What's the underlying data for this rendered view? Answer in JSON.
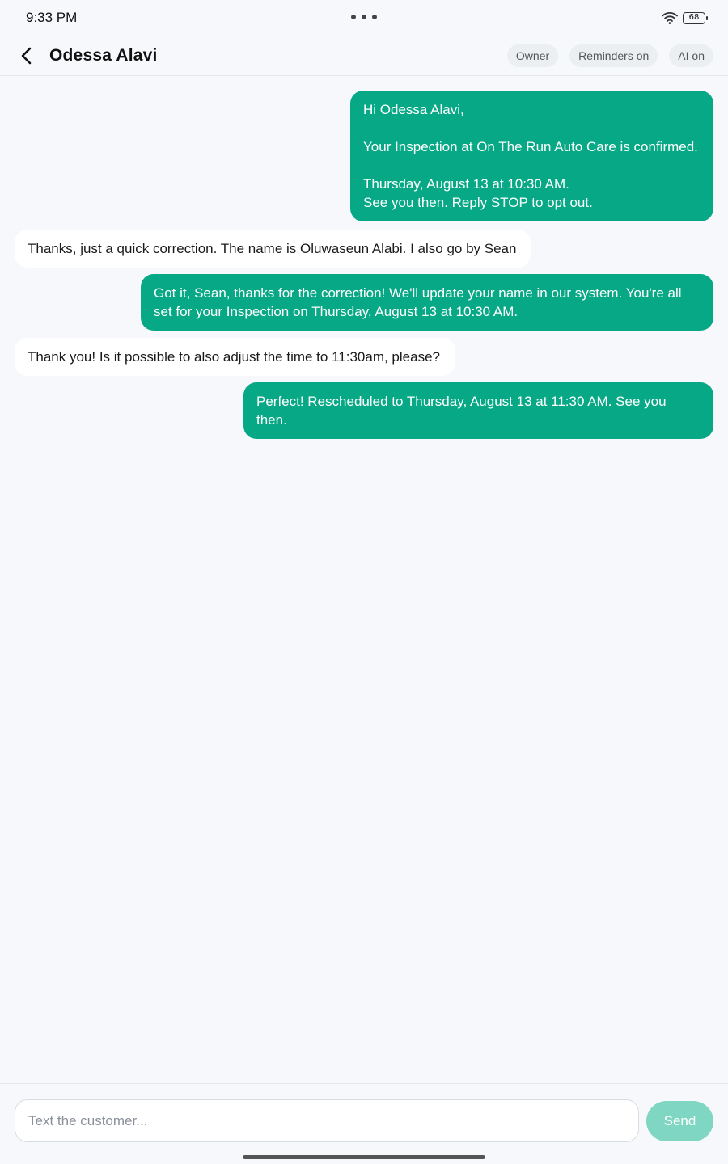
{
  "status_bar": {
    "time": "9:33 PM",
    "battery": "68"
  },
  "header": {
    "title": "Odessa Alavi",
    "chips": [
      "Owner",
      "Reminders on",
      "AI on"
    ]
  },
  "messages": [
    {
      "direction": "out",
      "text": "Hi Odessa Alavi,\n\nYour Inspection at On The Run Auto Care is confirmed.\n\nThursday, August 13 at 10:30 AM.\nSee you then. Reply STOP to opt out."
    },
    {
      "direction": "in",
      "text": "Thanks, just a quick correction. The name is Oluwaseun Alabi. I also go by Sean"
    },
    {
      "direction": "out",
      "text": "Got it, Sean, thanks for the correction! We'll update your name in our system. You're all set for your Inspection on Thursday, August 13 at 10:30 AM."
    },
    {
      "direction": "in",
      "text": "Thank you! Is it possible to also adjust the time to 11:30am, please?"
    },
    {
      "direction": "out",
      "text": "Perfect! Rescheduled to Thursday, August 13 at 11:30 AM. See you then."
    }
  ],
  "composer": {
    "placeholder": "Text the customer...",
    "send_label": "Send"
  },
  "colors": {
    "outgoing_bubble": "#06a885",
    "incoming_bubble": "#ffffff",
    "send_disabled": "#7fd6c2"
  }
}
